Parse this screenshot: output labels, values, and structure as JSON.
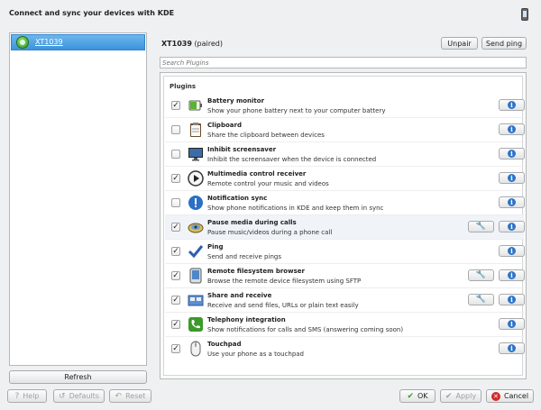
{
  "window": {
    "title": "Connect and sync your devices with KDE"
  },
  "devices": [
    {
      "label": "XT1039"
    }
  ],
  "left": {
    "refresh_label": "Refresh"
  },
  "device": {
    "name": "XT1039",
    "status": "(paired)",
    "unpair_label": "Unpair",
    "ping_label": "Send ping"
  },
  "search": {
    "placeholder": "Search Plugins"
  },
  "plugins": {
    "heading": "Plugins",
    "items": [
      {
        "name": "Battery monitor",
        "desc": "Show your phone battery next to your computer battery",
        "checked": true,
        "configurable": false,
        "icon": "battery-icon"
      },
      {
        "name": "Clipboard",
        "desc": "Share the clipboard between devices",
        "checked": false,
        "configurable": false,
        "icon": "clipboard-icon"
      },
      {
        "name": "Inhibit screensaver",
        "desc": "Inhibit the screensaver when the device is connected",
        "checked": false,
        "configurable": false,
        "icon": "monitor-icon"
      },
      {
        "name": "Multimedia control receiver",
        "desc": "Remote control your music and videos",
        "checked": true,
        "configurable": false,
        "icon": "play-icon"
      },
      {
        "name": "Notification sync",
        "desc": "Show phone notifications in KDE and keep them in sync",
        "checked": false,
        "configurable": false,
        "icon": "notification-icon"
      },
      {
        "name": "Pause media during calls",
        "desc": "Pause music/videos during a phone call",
        "checked": true,
        "configurable": true,
        "icon": "speaker-icon"
      },
      {
        "name": "Ping",
        "desc": "Send and receive pings",
        "checked": true,
        "configurable": false,
        "icon": "checkmark-icon"
      },
      {
        "name": "Remote filesystem browser",
        "desc": "Browse the remote device filesystem using SFTP",
        "checked": true,
        "configurable": true,
        "icon": "device-icon"
      },
      {
        "name": "Share and receive",
        "desc": "Receive and send files, URLs or plain text easily",
        "checked": true,
        "configurable": true,
        "icon": "share-icon"
      },
      {
        "name": "Telephony integration",
        "desc": "Show notifications for calls and SMS (answering coming soon)",
        "checked": true,
        "configurable": false,
        "icon": "phone-icon"
      },
      {
        "name": "Touchpad",
        "desc": "Use your phone as a touchpad",
        "checked": true,
        "configurable": false,
        "icon": "mouse-icon"
      }
    ]
  },
  "footer": {
    "help_label": "Help",
    "defaults_label": "Defaults",
    "reset_label": "Reset",
    "ok_label": "OK",
    "apply_label": "Apply",
    "cancel_label": "Cancel"
  },
  "colors": {
    "accent": "#3d94dc",
    "info": "#2e74c8",
    "ok_green": "#3b9a2a",
    "cancel_red": "#d22a2a"
  }
}
